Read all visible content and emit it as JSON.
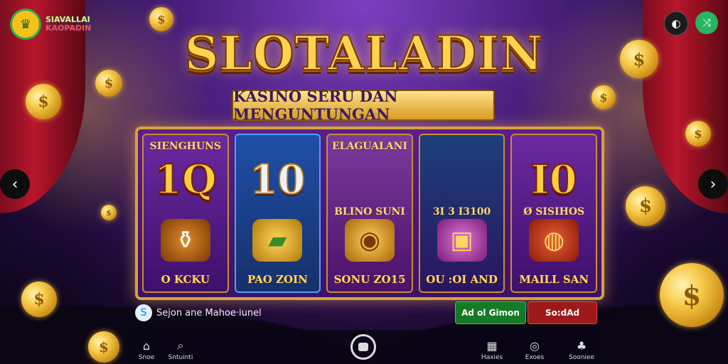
{
  "brand": {
    "line1": "SIAVALLAI",
    "line2": "KAOPADIN"
  },
  "title": "SLOTALADIN",
  "subtitle": "KASINO SERU DAN MENGUNTUNGAN",
  "columns": [
    {
      "header": "SIENGHUNS",
      "big": "1Q",
      "mid": "",
      "footer": "O KCKU",
      "icon": "coin-pot-icon",
      "icon_glyph": "⚱"
    },
    {
      "header": "",
      "big": "10",
      "mid": "",
      "footer": "PAO ZOIN",
      "icon": "gold-bar-icon",
      "icon_glyph": "▰"
    },
    {
      "header": "ELAGUALANI",
      "big": "",
      "mid": "BLINO SUNI",
      "footer": "SONU ZO15",
      "icon": "treasure-chest-icon",
      "icon_glyph": "◉"
    },
    {
      "header": "",
      "big": "",
      "mid": "3I 3 I3100",
      "footer": "OU :OI AND",
      "icon": "gift-box-icon",
      "icon_glyph": "▣"
    },
    {
      "header": "",
      "big": "I0",
      "mid": "Ø SISIHOS",
      "footer": "MAILL SAN",
      "icon": "lamp-icon",
      "icon_glyph": "◍"
    }
  ],
  "info": {
    "label": "Sejon ane Mahoe·iunel"
  },
  "cta": {
    "primary": "Ad ol Gimon",
    "secondary": "So:dAd"
  },
  "nav": [
    {
      "label": "Snoe",
      "icon": "home-icon",
      "glyph": "⌂"
    },
    {
      "label": "Sntuinti",
      "icon": "search-icon",
      "glyph": "⌕"
    },
    {
      "label": "Haxies",
      "icon": "list-icon",
      "glyph": "▦"
    },
    {
      "label": "Exoes",
      "icon": "settings-icon",
      "glyph": "◎"
    },
    {
      "label": "Sooniee",
      "icon": "clover-icon",
      "glyph": "♣"
    }
  ],
  "colors": {
    "gold": "#ffd34d",
    "accent_green": "#28b463",
    "accent_red": "#9e1a1a",
    "panel": "#3c1168"
  }
}
